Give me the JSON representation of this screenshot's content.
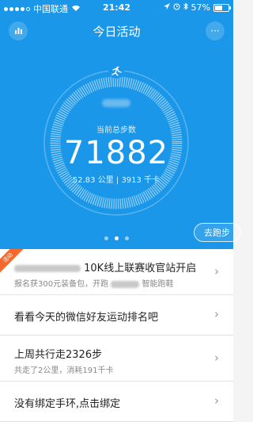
{
  "status_bar": {
    "carrier": "中国联通",
    "time": "21:42",
    "battery": "57%",
    "battery_level": 0.57
  },
  "header": {
    "title": "今日活动",
    "more_label": "···"
  },
  "summary": {
    "label": "当前总步数",
    "steps": "71882",
    "distance_calories": "52.83 公里 | 3913 千卡"
  },
  "pager": {
    "pages": 3,
    "active_index": 1
  },
  "run_button": {
    "label": "去跑步"
  },
  "list": {
    "promo": {
      "badge": "活动",
      "title": "10K线上联赛收官站开启",
      "sub_prefix": "报名获300元装备包，开跑",
      "sub_suffix": "智能跑鞋"
    },
    "ranking": {
      "title": "看看今天的微信好友运动排名吧"
    },
    "last_week": {
      "title": "上周共行走2326步",
      "sub": "共走了2公里，消耗191千卡"
    },
    "bind_band": {
      "title": "没有绑定手环,点击绑定"
    }
  },
  "colors": {
    "accent": "#1a97e9",
    "ribbon": "#f4692b"
  }
}
